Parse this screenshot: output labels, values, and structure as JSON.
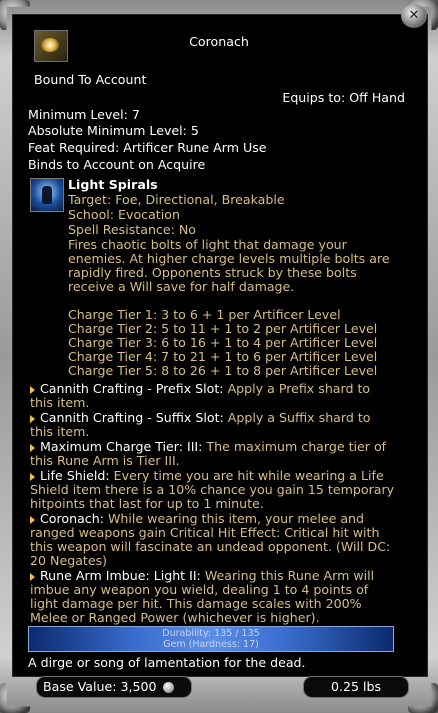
{
  "item": {
    "name": "Coronach",
    "binding": "Bound To Account",
    "equips_to": "Equips to: Off Hand",
    "min_level": "Minimum Level: 7",
    "abs_min_level": "Absolute Minimum Level: 5",
    "feat_required": "Feat Required: Artificer Rune Arm Use",
    "binds_on": "Binds to Account on Acquire"
  },
  "spell": {
    "name": "Light Spirals",
    "target": "Target: Foe, Directional, Breakable",
    "school": "School: Evocation",
    "resistance": "Spell Resistance: No",
    "desc": [
      "Fires chaotic bolts of light that damage your",
      "enemies. At higher charge levels multiple bolts are",
      "rapidly fired. Opponents struck by these bolts",
      "receive a Will save for half damage."
    ],
    "tiers": [
      "Charge Tier 1: 3 to 6 + 1 per Artificer Level",
      "Charge Tier 2: 5 to 11 + 1 to 2 per Artificer Level",
      "Charge Tier 3: 6 to 16 + 1 to 4 per Artificer Level",
      "Charge Tier 4: 7 to 21 + 1 to 6 per Artificer Level",
      "Charge Tier 5: 8 to 26 + 1 to 8 per Artificer Level"
    ]
  },
  "effects": [
    {
      "label": "Cannith Crafting - Prefix Slot:",
      "lines": [
        " Apply a Prefix shard to",
        "this item."
      ]
    },
    {
      "label": "Cannith Crafting - Suffix Slot:",
      "lines": [
        " Apply a Suffix shard to",
        "this item."
      ]
    },
    {
      "label": "Maximum Charge Tier: III:",
      "lines": [
        " The maximum charge tier of",
        "this Rune Arm is Tier III."
      ]
    },
    {
      "label": "Life Shield:",
      "lines": [
        " Every time you are hit while wearing a Life",
        "Shield item there is a 10% chance you gain 15 temporary",
        "hitpoints that last for up to 1 minute."
      ]
    },
    {
      "label": "Coronach:",
      "lines": [
        " While wearing this item, your melee and",
        "ranged weapons gain Critical Hit Effect: Critical hit with",
        "this weapon will fascinate an undead opponent. (Will DC:",
        "20 Negates)"
      ]
    },
    {
      "label": "Rune Arm Imbue: Light II:",
      "lines": [
        " Wearing this Rune Arm will",
        "imbue any weapon you wield, dealing 1 to 4 points of",
        "light damage per hit. This damage scales with 200%",
        "Melee or Ranged Power (whichever is higher)."
      ]
    }
  ],
  "durability": "Durability: 135 / 135",
  "material": "Gem (Hardness: 17)",
  "flavor": "A dirge or song of lamentation for the dead.",
  "base_value": "Base Value: 3,500",
  "weight": "0.25 lbs",
  "icons": {
    "item": "coronach-gem-icon",
    "spell": "light-spirals-icon",
    "close": "close-icon",
    "coin": "platinum-coin-icon"
  }
}
